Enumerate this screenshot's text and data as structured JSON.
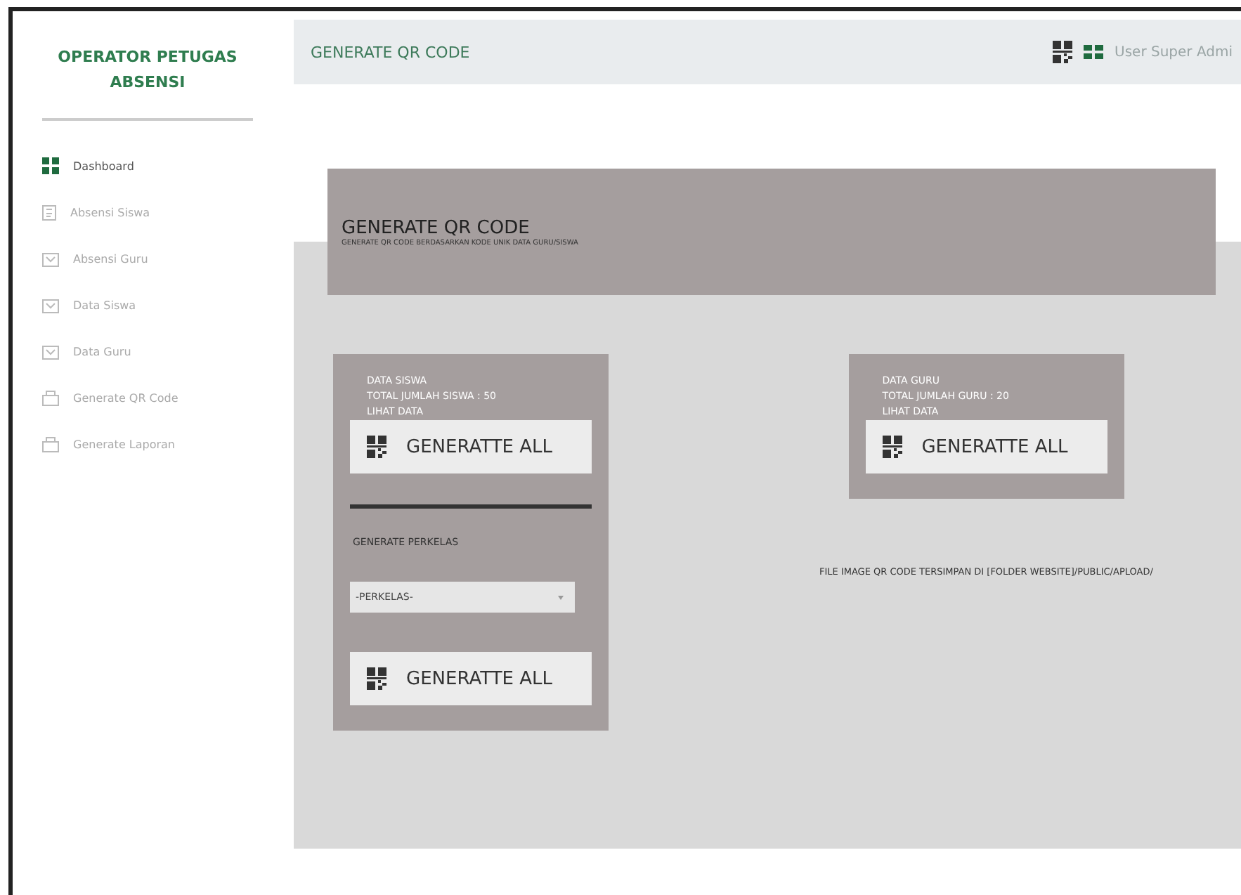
{
  "sidebar": {
    "title": "OPERATOR PETUGAS ABSENSI",
    "items": [
      {
        "label": "Dashboard",
        "kind": "grid",
        "selected": true
      },
      {
        "label": "Absensi Siswa",
        "kind": "clipboard",
        "selected": false
      },
      {
        "label": "Absensi Guru",
        "kind": "calendar",
        "selected": false
      },
      {
        "label": "Data Siswa",
        "kind": "calendar",
        "selected": false
      },
      {
        "label": "Data Guru",
        "kind": "calendar",
        "selected": false
      },
      {
        "label": "Generate QR Code",
        "kind": "bag",
        "selected": false
      },
      {
        "label": "Generate Laporan",
        "kind": "bag",
        "selected": false
      }
    ]
  },
  "header": {
    "title": "GENERATE QR CODE",
    "user": "User Super Admi"
  },
  "banner": {
    "title": "GENERATE QR CODE",
    "subtitle": "GENERATE QR CODE BERDASARKAN KODE UNIK DATA GURU/SISWA"
  },
  "siswa_card": {
    "lines": [
      "DATA SISWA",
      "TOTAL JUMLAH SISWA : 50"
    ],
    "link": "LIHAT DATA",
    "button": "GENERATTE ALL",
    "perkelas_label": "GENERATE PERKELAS",
    "select": "-PERKELAS-",
    "button2": "GENERATTE ALL"
  },
  "guru_card": {
    "lines": [
      "DATA GURU",
      "TOTAL JUMLAH GURU : 20"
    ],
    "link": "LIHAT DATA",
    "button": "GENERATTE ALL"
  },
  "note": "FILE IMAGE QR CODE TERSIMPAN DI [FOLDER WEBSITE]/PUBLIC/APLOAD/"
}
